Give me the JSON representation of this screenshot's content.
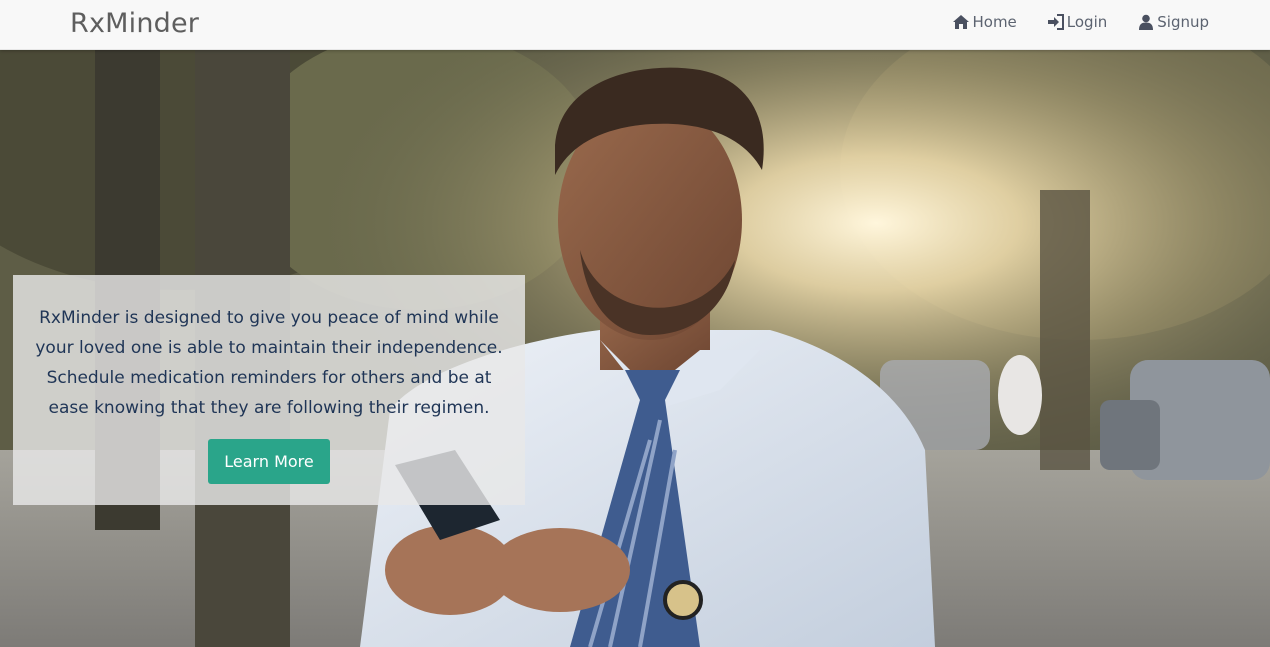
{
  "navbar": {
    "brand": "RxMinder",
    "links": [
      {
        "label": "Home",
        "icon": "home-icon"
      },
      {
        "label": "Login",
        "icon": "login-icon"
      },
      {
        "label": "Signup",
        "icon": "user-icon"
      }
    ]
  },
  "hero": {
    "description": "RxMinder is designed to give you peace of mind while your loved one is able to maintain their independence. Schedule medication reminders for others and be at ease knowing that they are following their regimen.",
    "button_label": "Learn More",
    "image": "photo of a man in a white shirt and tie smiling at his phone outdoors at sunset"
  },
  "colors": {
    "navbar_bg": "#f8f8f8",
    "brand_text": "#5e5e5e",
    "nav_text": "#5c6370",
    "card_text": "#1f3556",
    "button_bg": "#2aa58a"
  }
}
